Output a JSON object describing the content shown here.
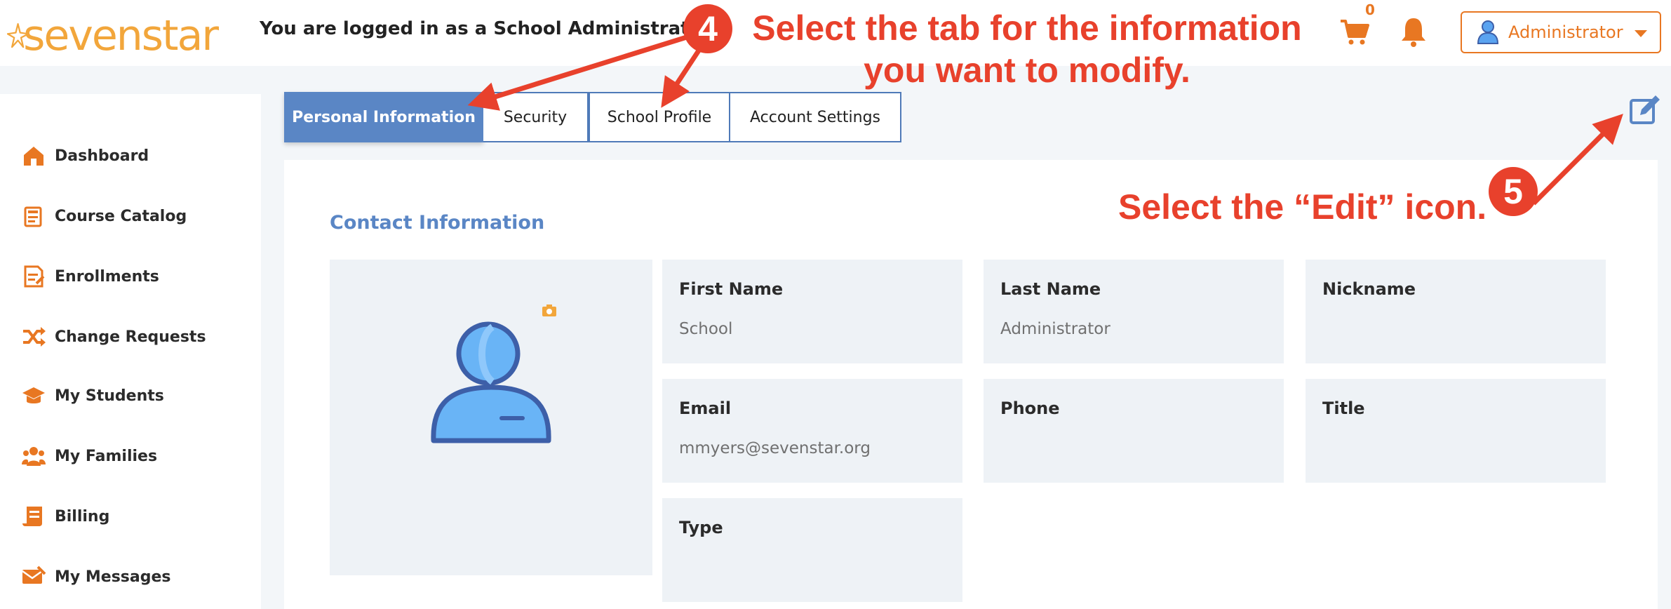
{
  "header": {
    "logo_text": "sevenstar",
    "logged_in_text": "You are logged in as a School Administrator",
    "cart_count": "0",
    "user_menu_label": "Administrator"
  },
  "sidebar": {
    "items": [
      {
        "label": "Dashboard",
        "icon": "home-icon"
      },
      {
        "label": "Course Catalog",
        "icon": "catalog-icon"
      },
      {
        "label": "Enrollments",
        "icon": "enrollments-icon"
      },
      {
        "label": "Change Requests",
        "icon": "shuffle-icon"
      },
      {
        "label": "My Students",
        "icon": "graduation-cap-icon"
      },
      {
        "label": "My Families",
        "icon": "users-icon"
      },
      {
        "label": "Billing",
        "icon": "billing-icon"
      },
      {
        "label": "My Messages",
        "icon": "messages-icon"
      }
    ]
  },
  "tabs": [
    {
      "label": "Personal Information",
      "active": true
    },
    {
      "label": "Security",
      "active": false
    },
    {
      "label": "School Profile",
      "active": false
    },
    {
      "label": "Account Settings",
      "active": false
    }
  ],
  "contact": {
    "title": "Contact Information",
    "fields": {
      "first_name": {
        "label": "First Name",
        "value": "School"
      },
      "last_name": {
        "label": "Last Name",
        "value": "Administrator"
      },
      "nickname": {
        "label": "Nickname",
        "value": ""
      },
      "email": {
        "label": "Email",
        "value": "mmyers@sevenstar.org"
      },
      "phone": {
        "label": "Phone",
        "value": ""
      },
      "title": {
        "label": "Title",
        "value": ""
      },
      "type": {
        "label": "Type",
        "value": ""
      }
    }
  },
  "annotations": {
    "step4_number": "4",
    "step4_line1": "Select the tab for the information",
    "step4_line2": "you want to modify.",
    "step5_number": "5",
    "step5_text": "Select the “Edit” icon."
  },
  "colors": {
    "accent_orange": "#e87722",
    "tab_blue": "#5a86c5",
    "annotation_red": "#e8412c"
  }
}
